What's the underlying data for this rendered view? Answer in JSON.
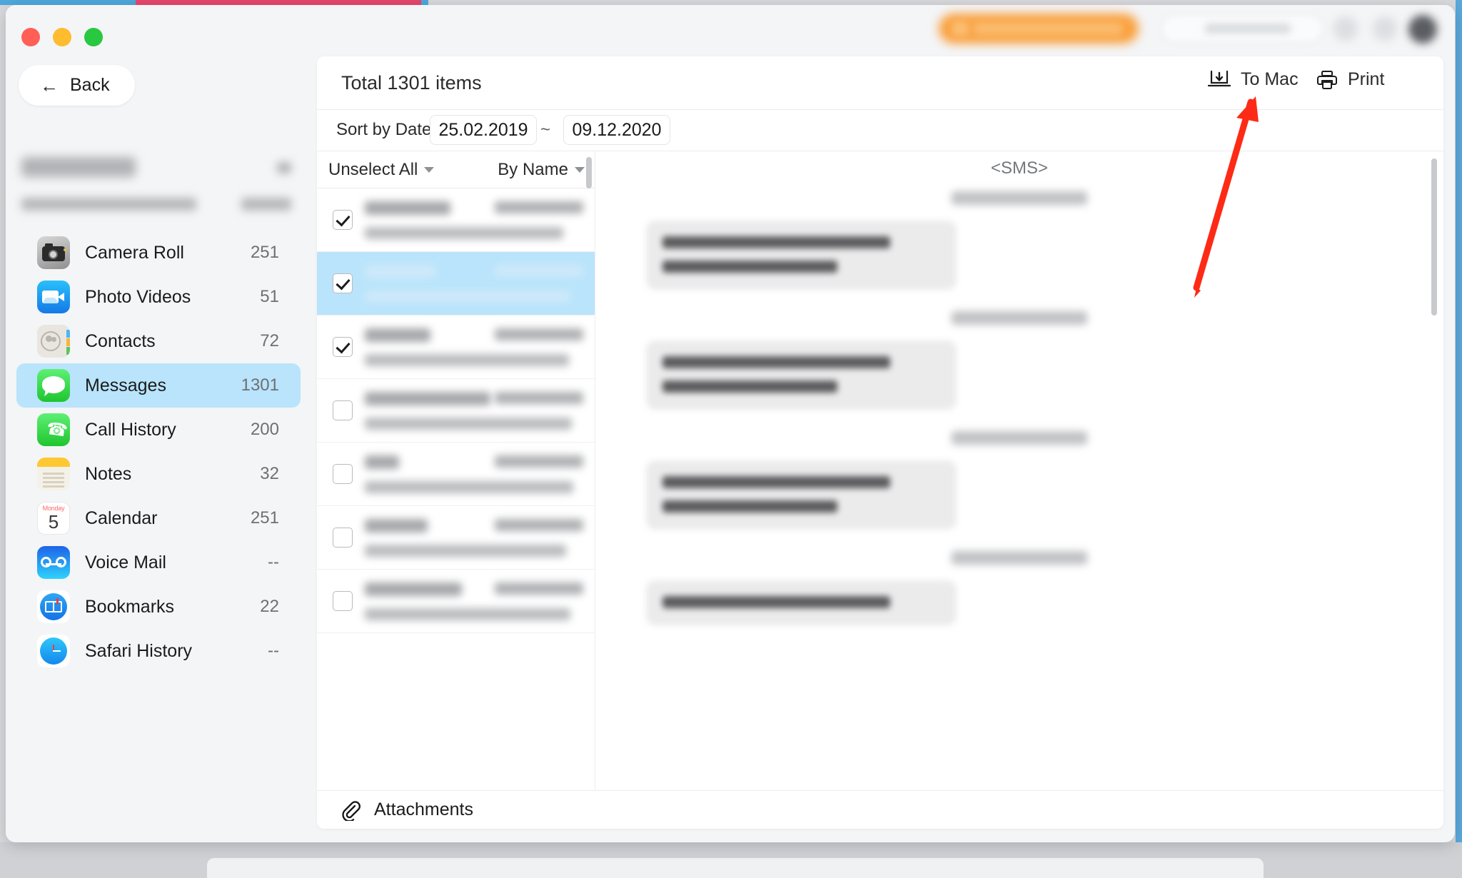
{
  "window": {
    "traffic_lights": [
      "close",
      "minimize",
      "maximize"
    ],
    "back_label": "Back",
    "back_icon": "arrow-left-icon"
  },
  "sidebar": {
    "device_name_redacted": true,
    "items": [
      {
        "label": "Camera Roll",
        "count": "251",
        "icon": "camera-roll-icon",
        "active": false
      },
      {
        "label": "Photo Videos",
        "count": "51",
        "icon": "photo-videos-icon",
        "active": false
      },
      {
        "label": "Contacts",
        "count": "72",
        "icon": "contacts-icon",
        "active": false
      },
      {
        "label": "Messages",
        "count": "1301",
        "icon": "messages-icon",
        "active": true
      },
      {
        "label": "Call History",
        "count": "200",
        "icon": "call-history-icon",
        "active": false
      },
      {
        "label": "Notes",
        "count": "32",
        "icon": "notes-icon",
        "active": false
      },
      {
        "label": "Calendar",
        "count": "251",
        "icon": "calendar-icon",
        "active": false
      },
      {
        "label": "Voice Mail",
        "count": "--",
        "icon": "voice-mail-icon",
        "active": false
      },
      {
        "label": "Bookmarks",
        "count": "22",
        "icon": "bookmarks-icon",
        "active": false
      },
      {
        "label": "Safari History",
        "count": "--",
        "icon": "safari-history-icon",
        "active": false
      }
    ],
    "calendar_icon": {
      "weekday": "Monday",
      "day": "5"
    }
  },
  "content": {
    "total_items": "Total 1301 items",
    "to_mac_label": "To Mac",
    "to_mac_icon": "export-to-mac-icon",
    "print_label": "Print",
    "print_icon": "printer-icon",
    "date_sort": {
      "label": "Sort by Date:",
      "from": "25.02.2019",
      "separator": "~",
      "to": "09.12.2020"
    },
    "list_toolbar": {
      "select_label": "Unselect All",
      "sort_label": "By Name",
      "caret_icon": "chevron-down-icon"
    },
    "detail_title": "<SMS>",
    "attachments_label": "Attachments",
    "attachments_icon": "paperclip-icon"
  },
  "message_list": [
    {
      "checked": true,
      "selected": false,
      "redacted": true
    },
    {
      "checked": true,
      "selected": true,
      "redacted": true
    },
    {
      "checked": true,
      "selected": false,
      "redacted": true
    },
    {
      "checked": false,
      "selected": false,
      "redacted": true
    },
    {
      "checked": false,
      "selected": false,
      "redacted": true
    },
    {
      "checked": false,
      "selected": false,
      "redacted": true
    },
    {
      "checked": false,
      "selected": false,
      "redacted": true
    }
  ],
  "bubbles": [
    {
      "redacted": true,
      "lines": 2
    },
    {
      "redacted": true,
      "lines": 2
    },
    {
      "redacted": true,
      "lines": 2
    },
    {
      "redacted": true,
      "lines": 1
    }
  ],
  "annotation": {
    "arrow": "red-arrow-annotation",
    "color": "#fd2b15",
    "points_to": "To Mac"
  },
  "menubar": {
    "promo_button": "redacted",
    "feedback_button": "redacted",
    "icons": [
      "redacted-icon-1",
      "redacted-icon-2",
      "user-avatar"
    ],
    "promo_color": "#f9a03c"
  },
  "colors": {
    "accent_selection": "#b9e4fb",
    "panel": "#ffffff",
    "sidebar": "#f4f5f7",
    "annotation_red": "#fd2b15"
  }
}
